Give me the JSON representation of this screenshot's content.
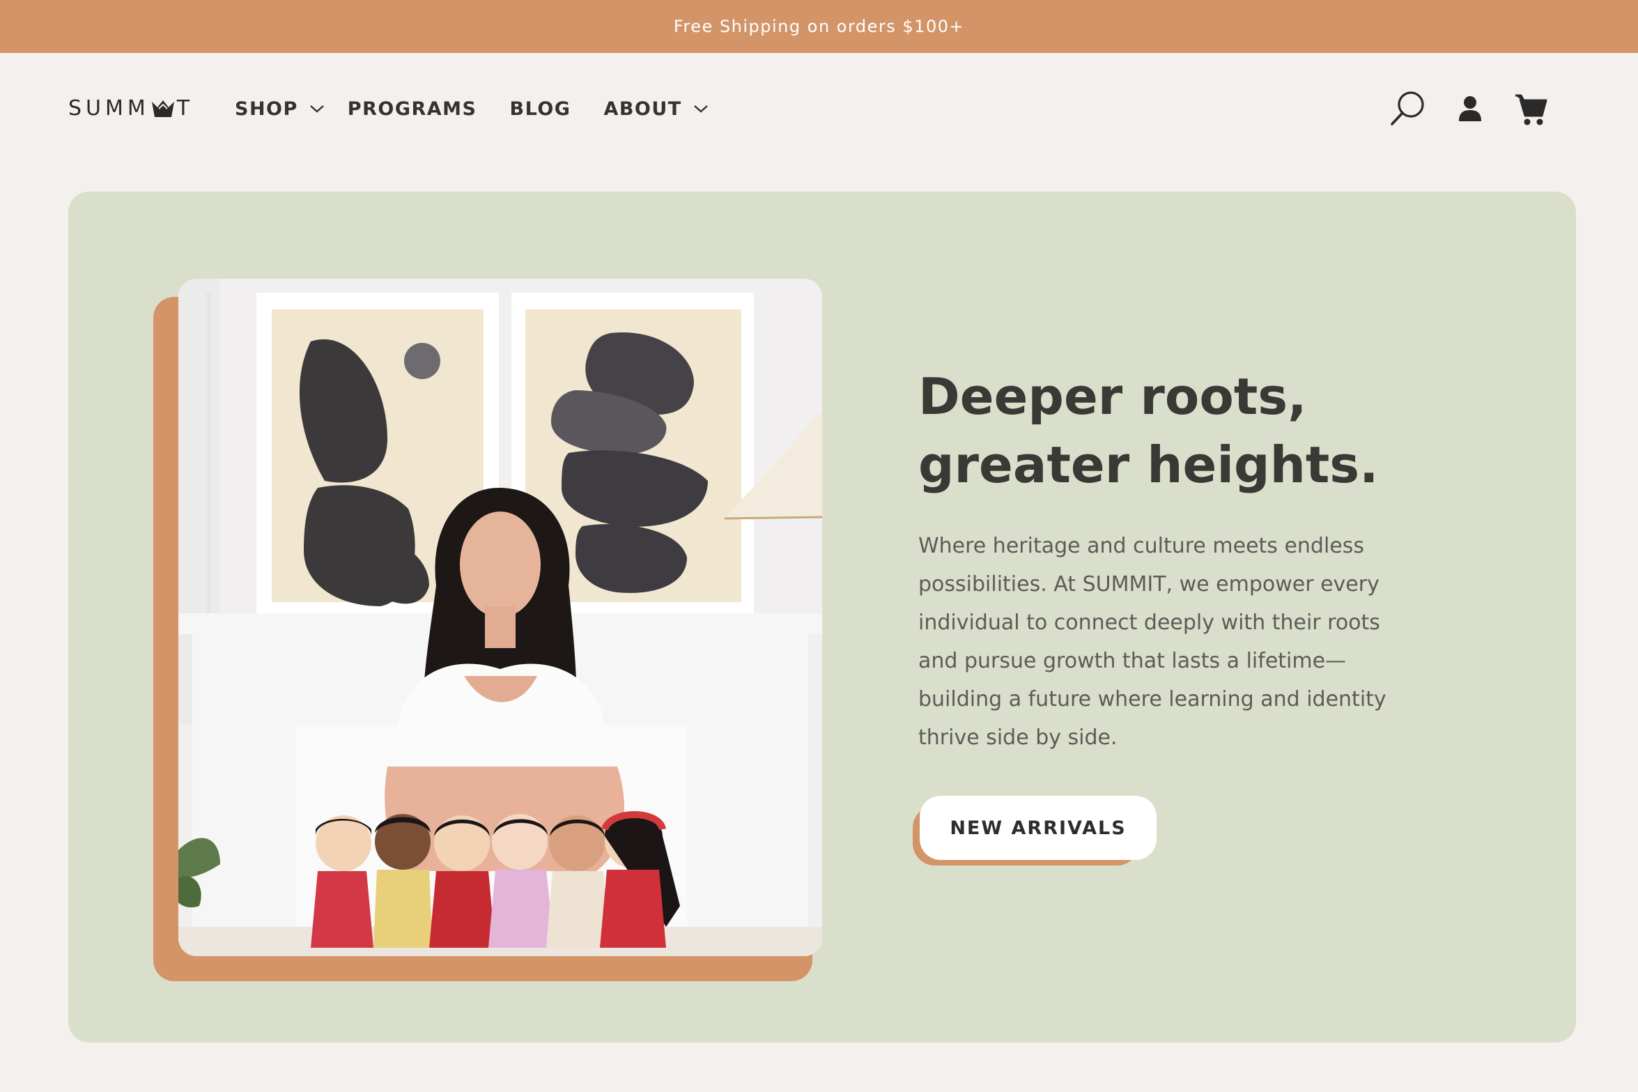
{
  "announcement": {
    "text": "Free Shipping on orders $100+"
  },
  "brand": {
    "logo_left": "SUMM",
    "logo_right": "T"
  },
  "nav": {
    "items": [
      {
        "label": "SHOP",
        "has_dropdown": true
      },
      {
        "label": "PROGRAMS",
        "has_dropdown": false
      },
      {
        "label": "BLOG",
        "has_dropdown": false
      },
      {
        "label": "ABOUT",
        "has_dropdown": true
      }
    ]
  },
  "header_icons": [
    "search-icon",
    "account-icon",
    "cart-icon"
  ],
  "hero": {
    "headline_line1": "Deeper roots,",
    "headline_line2": "greater heights.",
    "body": "Where heritage and culture meets endless possibilities. At SUMMIT, we empower every individual to connect deeply with their roots and pursue growth that lasts a lifetime— building a future where learning and identity thrive side by side.",
    "cta_label": "NEW ARRIVALS"
  },
  "colors": {
    "accent": "#d39467",
    "hero_bg": "#d9dfcb",
    "page_bg": "#f3f0ee",
    "text_dark": "#393935"
  }
}
